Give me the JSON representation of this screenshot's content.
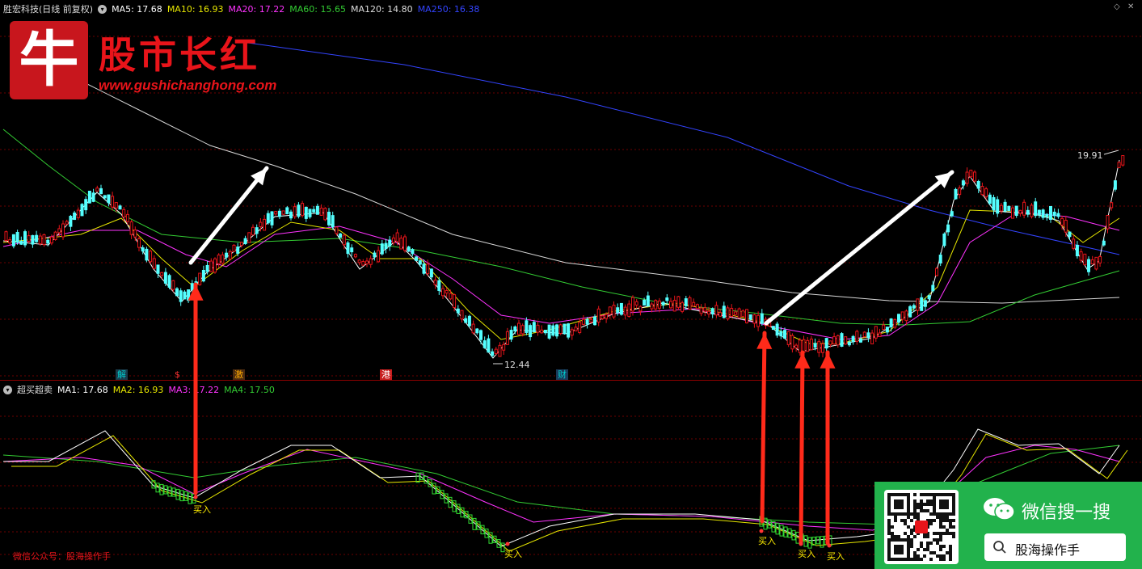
{
  "main_legend": {
    "title": "胜宏科技",
    "period": "(日线 前复权)",
    "items": [
      {
        "label": "MA5: 17.68",
        "color": "#ffffff"
      },
      {
        "label": "MA10: 16.93",
        "color": "#e6e600"
      },
      {
        "label": "MA20: 17.22",
        "color": "#ff33ff"
      },
      {
        "label": "MA60: 15.65",
        "color": "#33cc33"
      },
      {
        "label": "MA120: 14.80",
        "color": "#dddddd"
      },
      {
        "label": "MA250: 16.38",
        "color": "#3344ff"
      }
    ]
  },
  "sub_legend": {
    "title": "超买超卖",
    "items": [
      {
        "label": "MA1: 17.68",
        "color": "#ffffff"
      },
      {
        "label": "MA2: 16.93",
        "color": "#e6e600"
      },
      {
        "label": "MA3: 17.22",
        "color": "#ff33ff"
      },
      {
        "label": "MA4: 17.50",
        "color": "#33cc33"
      }
    ]
  },
  "logo": {
    "glyph": "牛",
    "title": "股市长红",
    "url": "www.gushichanghong.com"
  },
  "price_marks": {
    "high": "19.91",
    "low": "12.44"
  },
  "events": [
    {
      "text": "解",
      "color": "#00cccc",
      "bg": "#1a3a4a"
    },
    {
      "text": "$",
      "color": "#ff3333",
      "bg": "transparent"
    },
    {
      "text": "激",
      "color": "#ffaa00",
      "bg": "#4a2a10"
    },
    {
      "text": "港",
      "color": "#ffffff",
      "bg": "#c81e1e"
    },
    {
      "text": "财",
      "color": "#00cccc",
      "bg": "#1a3a5a"
    }
  ],
  "buy_signals": [
    "买入",
    "买入",
    "买入",
    "买入",
    "买入"
  ],
  "footer_note": "微信公众号：股海操作手",
  "wechat_card": {
    "title": "微信搜一搜",
    "search_text": "股海操作手"
  },
  "colors": {
    "up": "#e8141a",
    "down": "#54ffff",
    "grid": "#8b0000",
    "arrow_red": "#ff2a1a"
  }
}
